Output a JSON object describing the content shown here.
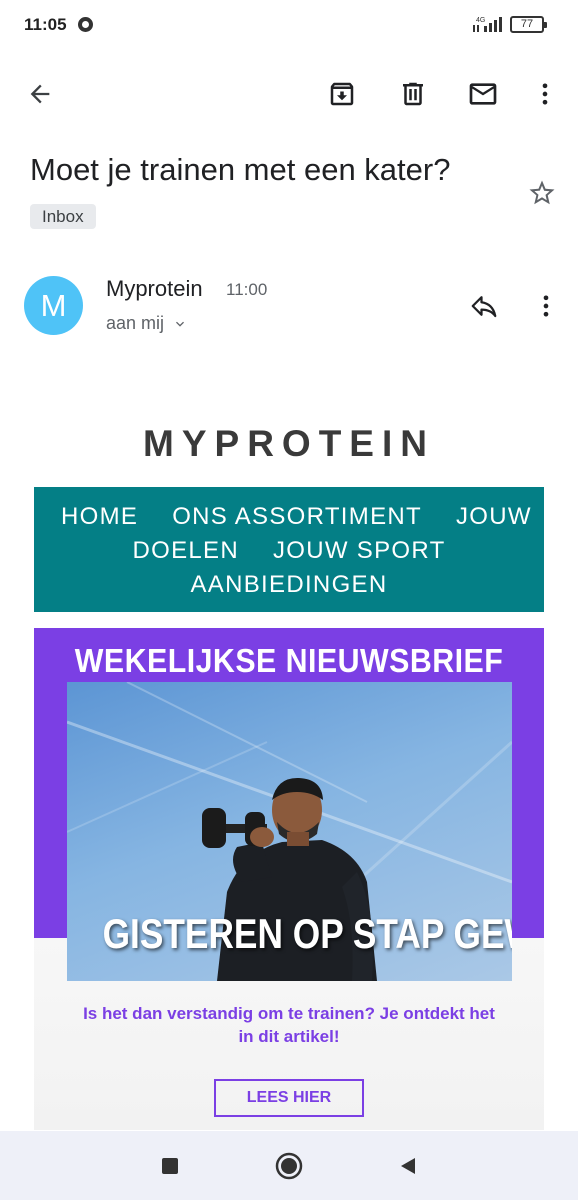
{
  "status_bar": {
    "time": "11:05",
    "network": "4G",
    "battery": "77"
  },
  "toolbar": {
    "back_icon": "arrow-left-icon",
    "archive_icon": "archive-icon",
    "delete_icon": "trash-icon",
    "mark_unread_icon": "mail-icon",
    "more_icon": "more-vert-icon"
  },
  "email": {
    "subject": "Moet je trainen met een kater?",
    "label": "Inbox",
    "sender": {
      "initial": "M",
      "name": "Myprotein",
      "time": "11:00",
      "recipient": "aan mij",
      "avatar_color": "#4fc3f7"
    }
  },
  "newsletter": {
    "brand": "MYPROTEIN",
    "nav_color": "#047f86",
    "nav_items": [
      "HOME",
      "ONS ASSORTIMENT",
      "JOUW DOELEN",
      "JOUW SPORT",
      "AANBIEDINGEN"
    ],
    "nav_lines": {
      "line1": [
        "HOME",
        "ONS ASSORTIMENT",
        "JOUW"
      ],
      "line2": [
        "DOELEN",
        "JOUW SPORT"
      ],
      "line3": [
        "AANBIEDINGEN"
      ]
    },
    "hero": {
      "accent_color": "#7b3fe4",
      "heading": "WEKELIJKSE NIEUWSBRIEF",
      "overlay": "GISTEREN OP STAP GEWEEST?",
      "subtitle": "Is het dan verstandig om te trainen? Je ontdekt het in dit artikel!",
      "cta": "LEES HIER"
    }
  },
  "system_nav": {
    "recents_icon": "square-icon",
    "home_icon": "circle-icon",
    "back_icon": "triangle-back-icon"
  }
}
